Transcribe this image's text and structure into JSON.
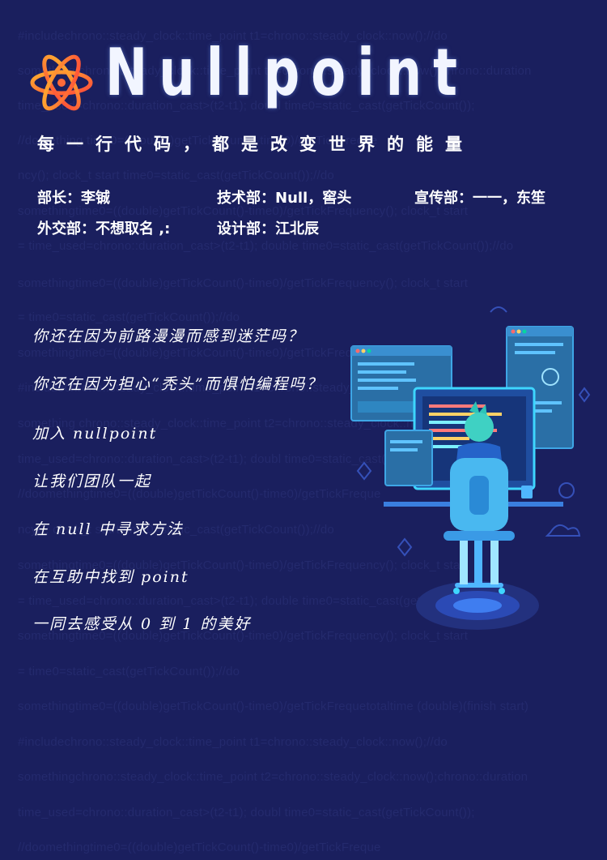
{
  "background_code": [
    "#includechrono::steady_clock::time_point   t1=chrono::steady_clock::now();//do",
    "something    chrono::steady_clock::time_point   t2=chrono::steady_clock::now();chrono::duration",
    "time_used=chrono::duration_cast>(t2-t1);   doubl time0=static_cast(getTickCount());",
    "//domething time0=((double)getTickCount()-time0)/getTickFreque",
    "ncy();  clock_t  start  time0=static_cast(getTickCount());//do",
    "somethingtime0=((double)getTickCount()-time0)/getTickFrequency();   clock_t  start",
    "=  time_used=chrono::duration_cast>(t2-t1);   double  time0=static_cast(getTickCount());//do",
    "somethingtime0=((double)getTickCount()-time0)/getTickFrequency();   clock_t  start",
    "=  time0=static_cast(getTickCount());//do",
    "somethingtime0=((double)getTickCount()-time0)/getTickFrequency();   double",
    "#includechrono::steady_clock::time_point   t1=chrono::steady_clock::now();//do",
    "something    chrono::steady_clock::time_point   t2=chrono::steady_clock::now();",
    "time_used=chrono::duration_cast>(t2-t1);   doubl time0=static_cast(getTickCount());",
    "//doomethingtime0=((double)getTickCount()-time0)/getTickFreque",
    "ncy();  clock_t  start  time0=static_cast(getTickCount());//do",
    "somethingtime0=((double)getTickCount()-time0)/getTickFrequency();   clock_t  start",
    "=  time_used=chrono::duration_cast>(t2-t1);   double  time0=static_cast(getTickCount());//do",
    "somethingtime0=((double)getTickCount()-time0)/getTickFrequency();   clock_t  start",
    "=  time0=static_cast(getTickCount());//do",
    "somethingtime0=((double)getTickCount()-time0)/getTickFrequetotaltime  (double)(finish  start)",
    "#includechrono::steady_clock::time_point   t1=chrono::steady_clock::now();//do",
    "somethingchrono::steady_clock::time_point   t2=chrono::steady_clock::now();chrono::duration",
    "time_used=chrono::duration_cast>(t2-t1);   doubl time0=static_cast(getTickCount());",
    "//doomethingtime0=((double)getTickCount()-time0)/getTickFreque"
  ],
  "brand": "Nullpoint",
  "slogan": "每一行代码，都是改变世界的能量",
  "team": {
    "leader": "部长：李铖",
    "tech": "技术部：Null，窖头",
    "promo": "宣传部：一一，东笙",
    "external": "外交部：不想取名 ,:",
    "design": "设计部：江北辰"
  },
  "lines": [
    "你还在因为前路漫漫而感到迷茫吗？",
    "你还在因为担心“秃头”而惧怕编程吗？",
    "加入 nullpoint",
    "让我们团队一起",
    "在 null 中寻求方法",
    "在互助中找到 point",
    "一同去感受从 0 到 1 的美好"
  ],
  "icons": [
    "atom-logo-icon",
    "programmer-illustration"
  ]
}
